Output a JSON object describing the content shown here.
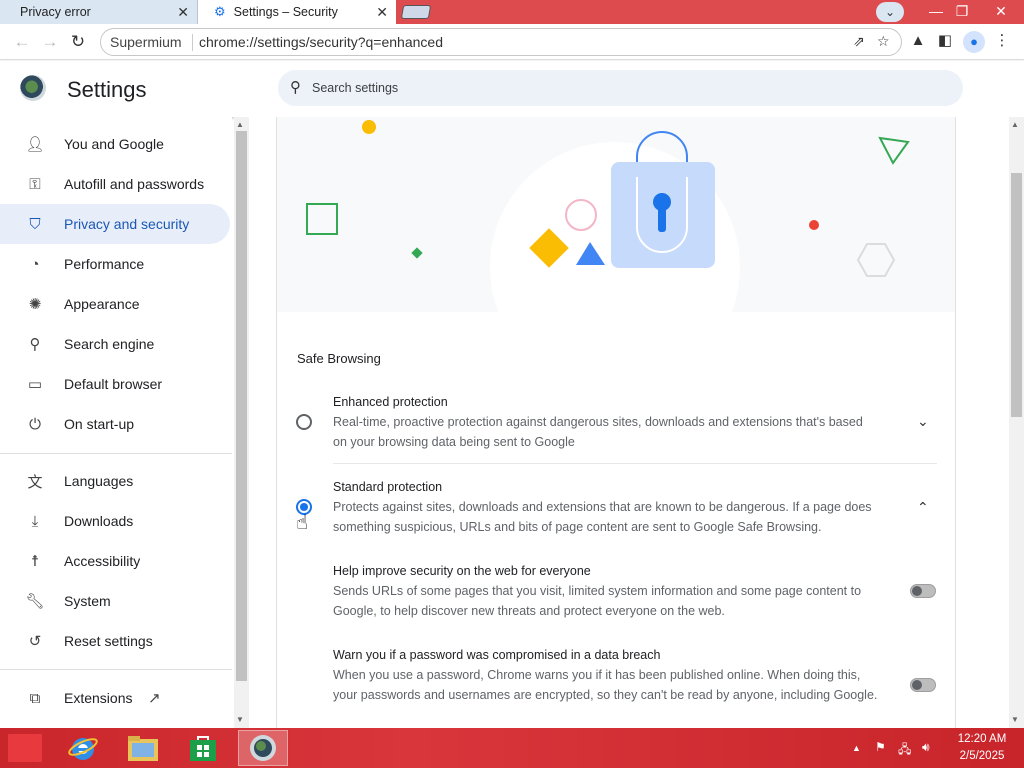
{
  "browser": {
    "tabs": [
      {
        "label": "Privacy error"
      },
      {
        "label": "Settings – Security"
      }
    ],
    "omnibox": {
      "site": "Supermium",
      "url": "chrome://settings/security?q=enhanced"
    },
    "tab_close_glyph": "✕",
    "window_controls": {
      "minimize": "—",
      "maximize": "❐",
      "close": "✕"
    }
  },
  "settings": {
    "title": "Settings",
    "search_placeholder": "Search settings",
    "sidebar": [
      {
        "label": "You and Google",
        "icon": "person-icon"
      },
      {
        "label": "Autofill and passwords",
        "icon": "key-icon"
      },
      {
        "label": "Privacy and security",
        "icon": "shield-icon"
      },
      {
        "label": "Performance",
        "icon": "speedometer-icon"
      },
      {
        "label": "Appearance",
        "icon": "palette-icon"
      },
      {
        "label": "Search engine",
        "icon": "search-icon"
      },
      {
        "label": "Default browser",
        "icon": "browser-window-icon"
      },
      {
        "label": "On start-up",
        "icon": "power-icon"
      },
      {
        "label": "Languages",
        "icon": "translate-icon"
      },
      {
        "label": "Downloads",
        "icon": "download-icon"
      },
      {
        "label": "Accessibility",
        "icon": "accessibility-icon"
      },
      {
        "label": "System",
        "icon": "wrench-icon"
      },
      {
        "label": "Reset settings",
        "icon": "reset-icon"
      },
      {
        "label": "Extensions",
        "icon": "puzzle-icon"
      }
    ],
    "safe_browsing": {
      "section_title": "Safe Browsing",
      "enhanced": {
        "title": "Enhanced protection",
        "description": "Real-time, proactive protection against dangerous sites, downloads and extensions that's based on your browsing data being sent to Google"
      },
      "standard": {
        "title": "Standard protection",
        "description": "Protects against sites, downloads and extensions that are known to be dangerous. If a page does something suspicious, URLs and bits of page content are sent to Google Safe Browsing."
      },
      "help_improve": {
        "title": "Help improve security on the web for everyone",
        "description": "Sends URLs of some pages that you visit, limited system information and some page content to Google, to help discover new threats and protect everyone on the web."
      },
      "password_warn": {
        "title": "Warn you if a password was compromised in a data breach",
        "description": "When you use a password, Chrome warns you if it has been published online. When doing this, your passwords and usernames are encrypted, so they can't be read by anyone, including Google."
      }
    }
  },
  "taskbar": {
    "clock_time": "12:20 AM",
    "clock_date": "2/5/2025"
  },
  "colors": {
    "accent": "#1a73e8",
    "taskbar": "#d8363b",
    "titlebar": "#dd4b4f"
  }
}
